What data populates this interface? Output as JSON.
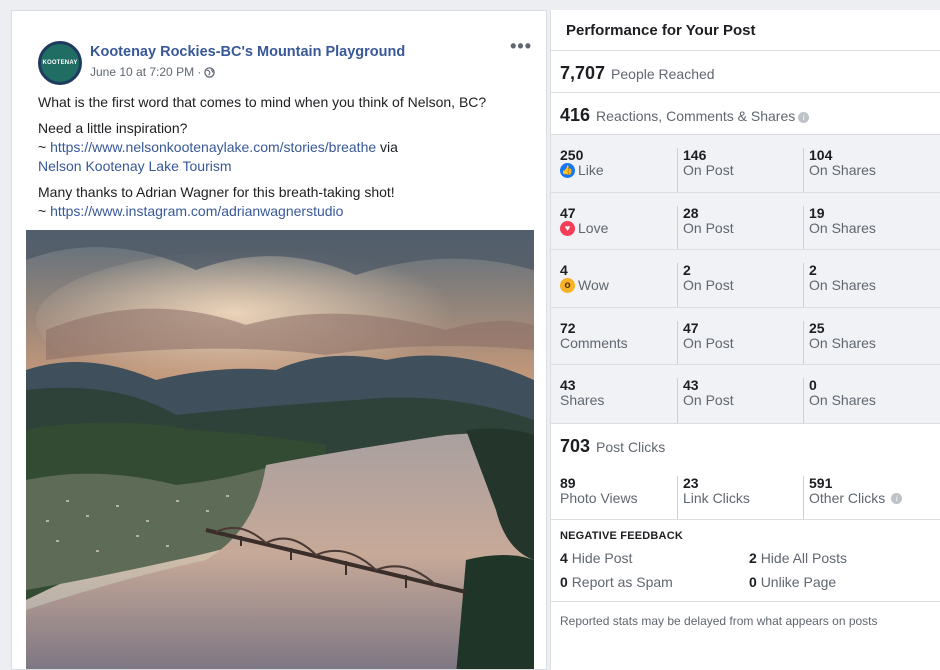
{
  "post": {
    "avatar_text": "KOOTENAY",
    "page_name": "Kootenay Rockies-BC's Mountain Playground",
    "date": "June 10 at 7:20 PM ·",
    "more": "•••",
    "question": "What is the first word that comes to mind when you think of Nelson, BC?",
    "inspiration": "Need a little inspiration?",
    "tilde1": "~ ",
    "story_link": "https://www.nelsonkootenaylake.com/stories/breathe",
    "via": " via",
    "tourism_link": "Nelson Kootenay Lake Tourism",
    "thanks": "Many thanks to Adrian Wagner for this breath-taking shot!",
    "tilde2": "~ ",
    "instagram_link": "https://www.instagram.com/adrianwagnerstudio"
  },
  "stats": {
    "title": "Performance for Your Post",
    "reached_num": "7,707",
    "reached_label": "People Reached",
    "engagement_num": "416",
    "engagement_label": "Reactions, Comments & Shares",
    "rows": [
      {
        "c1n": "250",
        "c1l": "Like",
        "icon": "like-icon",
        "c2n": "146",
        "c2l": "On Post",
        "c3n": "104",
        "c3l": "On Shares"
      },
      {
        "c1n": "47",
        "c1l": "Love",
        "icon": "love-icon",
        "c2n": "28",
        "c2l": "On Post",
        "c3n": "19",
        "c3l": "On Shares"
      },
      {
        "c1n": "4",
        "c1l": "Wow",
        "icon": "wow-icon",
        "c2n": "2",
        "c2l": "On Post",
        "c3n": "2",
        "c3l": "On Shares"
      },
      {
        "c1n": "72",
        "c1l": "Comments",
        "c2n": "47",
        "c2l": "On Post",
        "c3n": "25",
        "c3l": "On Shares"
      },
      {
        "c1n": "43",
        "c1l": "Shares",
        "c2n": "43",
        "c2l": "On Post",
        "c3n": "0",
        "c3l": "On Shares"
      }
    ],
    "clicks_num": "703",
    "clicks_label": "Post Clicks",
    "photo_views_num": "89",
    "photo_views_label": "Photo Views",
    "link_clicks_num": "23",
    "link_clicks_label": "Link Clicks",
    "other_clicks_num": "591",
    "other_clicks_label": "Other Clicks",
    "negative_title": "NEGATIVE FEEDBACK",
    "hide_post_num": "4",
    "hide_post_label": "Hide Post",
    "hide_all_num": "2",
    "hide_all_label": "Hide All Posts",
    "spam_num": "0",
    "spam_label": "Report as Spam",
    "unlike_num": "0",
    "unlike_label": "Unlike Page",
    "footnote": "Reported stats may be delayed from what appears on posts"
  },
  "colors": {
    "link": "#385898",
    "like": "#1877f2",
    "love": "#f33e58",
    "wow": "#f7b125"
  }
}
